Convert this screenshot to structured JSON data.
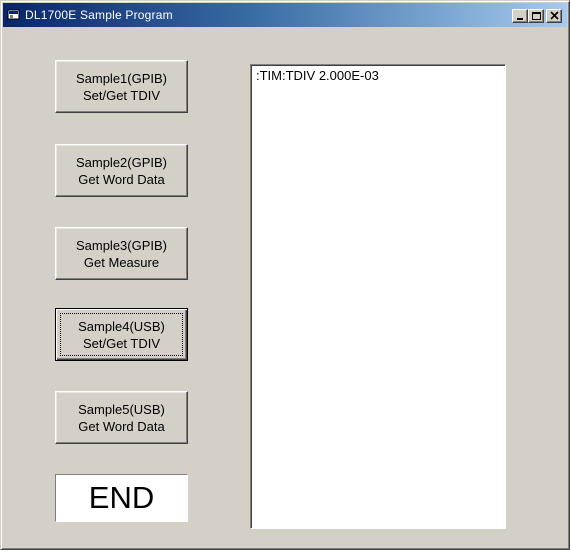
{
  "window": {
    "title": "DL1700E Sample Program"
  },
  "buttons": [
    {
      "line1": "Sample1(GPIB)",
      "line2": "Set/Get TDIV"
    },
    {
      "line1": "Sample2(GPIB)",
      "line2": "Get Word Data"
    },
    {
      "line1": "Sample3(GPIB)",
      "line2": "Get Measure"
    },
    {
      "line1": "Sample4(USB)",
      "line2": "Set/Get TDIV"
    },
    {
      "line1": "Sample5(USB)",
      "line2": "Get Word Data"
    }
  ],
  "end_label": "END",
  "output": {
    "text": ":TIM:TDIV 2.000E-03"
  },
  "colors": {
    "title_gradient_start": "#0a246a",
    "title_gradient_end": "#a6caf0",
    "face": "#d4d0c8"
  },
  "icons": {
    "app": "program-icon",
    "minimize": "minimize-icon",
    "maximize": "maximize-icon",
    "close": "close-icon"
  }
}
